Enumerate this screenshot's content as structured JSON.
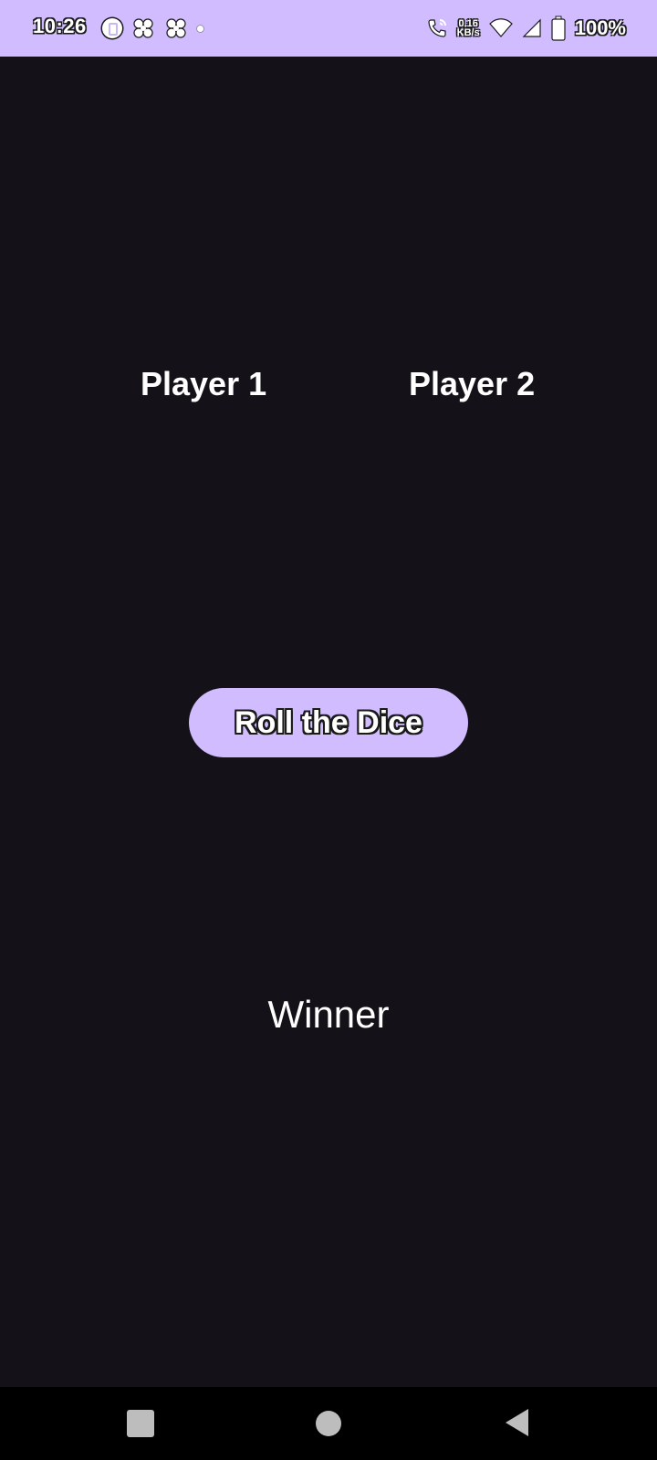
{
  "status_bar": {
    "time": "10:26",
    "net_speed_value": "0.16",
    "net_speed_unit": "KB/s",
    "battery_percent": "100%",
    "background_color": "#D0BCFF",
    "icons": [
      "app-notification-icon",
      "fan-icon",
      "fan-icon",
      "dot-icon",
      "wifi-calling-icon",
      "wifi-icon",
      "signal-icon",
      "battery-icon"
    ]
  },
  "game": {
    "player1_label": "Player 1",
    "player2_label": "Player 2",
    "roll_button_label": "Roll the Dice",
    "winner_label": "Winner"
  },
  "nav_bar": {
    "buttons": [
      "recents-button",
      "home-button",
      "back-button"
    ]
  },
  "colors": {
    "background": "#141218",
    "accent": "#D0BCFF",
    "text": "#FFFFFF"
  }
}
